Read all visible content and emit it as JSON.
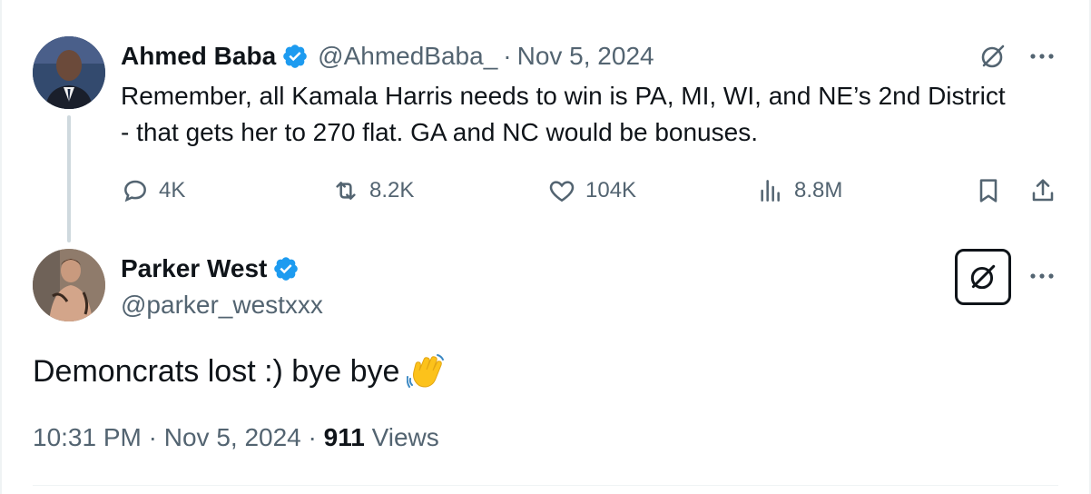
{
  "parent_tweet": {
    "display_name": "Ahmed Baba",
    "handle": "@AhmedBaba_",
    "separator": "·",
    "date": "Nov 5, 2024",
    "text": "Remember, all Kamala Harris needs to win is PA, MI, WI, and NE’s 2nd District - that gets her to 270 flat. GA and NC would be bonuses.",
    "stats": {
      "replies": "4K",
      "reposts": "8.2K",
      "likes": "104K",
      "views": "8.8M"
    },
    "icons": [
      "verified-badge-icon",
      "grok-icon",
      "more-icon",
      "reply-icon",
      "repost-icon",
      "like-icon",
      "views-icon",
      "bookmark-icon",
      "share-icon"
    ]
  },
  "reply_tweet": {
    "display_name": "Parker West",
    "handle": "@parker_westxxx",
    "text": "Demoncrats lost :) bye bye",
    "emoji": "waving-hand-icon",
    "time": "10:31 PM",
    "separator": "·",
    "date": "Nov 5, 2024",
    "separator2": "·",
    "views_count": "911",
    "views_label": "Views",
    "icons": [
      "verified-badge-icon",
      "grok-icon",
      "more-icon"
    ]
  },
  "colors": {
    "text_primary": "#0f1419",
    "text_secondary": "#536471",
    "verified_blue": "#1d9bf0",
    "divider": "#eff3f4",
    "thread_line": "#cfd9de"
  }
}
